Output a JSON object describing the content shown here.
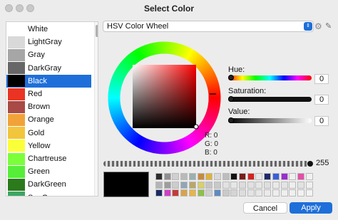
{
  "window": {
    "title": "Select Color"
  },
  "color_list": {
    "items": [
      {
        "label": "White",
        "color": "#ffffff"
      },
      {
        "label": "LightGray",
        "color": "#d9d9d9"
      },
      {
        "label": "Gray",
        "color": "#a6a6a6"
      },
      {
        "label": "DarkGray",
        "color": "#676767"
      },
      {
        "label": "Black",
        "color": "#000000",
        "selected": true
      },
      {
        "label": "Red",
        "color": "#ea3323"
      },
      {
        "label": "Brown",
        "color": "#a84a45"
      },
      {
        "label": "Orange",
        "color": "#f1a33a"
      },
      {
        "label": "Gold",
        "color": "#f2c53d"
      },
      {
        "label": "Yellow",
        "color": "#fbff3a"
      },
      {
        "label": "Chartreuse",
        "color": "#7bff3a"
      },
      {
        "label": "Green",
        "color": "#57ee3a"
      },
      {
        "label": "DarkGreen",
        "color": "#2b7a1c"
      },
      {
        "label": "SeaGreen",
        "color": "#3ea563"
      }
    ]
  },
  "mode_dropdown": {
    "value": "HSV Color Wheel"
  },
  "sliders": {
    "hue": {
      "label": "Hue:",
      "value": "0"
    },
    "saturation": {
      "label": "Saturation:",
      "value": "0"
    },
    "value": {
      "label": "Value:",
      "value": "0"
    }
  },
  "rgb_readout": {
    "r": "R: 0",
    "g": "G: 0",
    "b": "B: 0"
  },
  "opacity": {
    "value": "255"
  },
  "swatches": {
    "row1": [
      "#2d2d2d",
      "#8f8f8f",
      "#cfcfcf",
      "#b9b9b9",
      "#9ab0b0",
      "#c78a3d",
      "#e0b23c",
      "#d8d8d8",
      "#bdbdbd",
      "#111111",
      "#7a1c1c",
      "#d62020",
      "#e6e6e6",
      "#1e2a6a",
      "#3a5fd8",
      "#9b2ccf",
      "#f0f0f0",
      "#e34fa8",
      "#f1f1f1"
    ],
    "row2": [
      "#b4b4b4",
      "#9d9d9d",
      "#cccccc",
      "#8fa6b8",
      "#b8a86a",
      "#d9cf6c",
      "#c4c4c4",
      "#c8c8c8",
      "#e2e2e2",
      "#e6e6e6",
      "#dcdcdc",
      "#e1e1e1",
      "#e6e6e6",
      "#dedede",
      "#e9e9e9",
      "#e4e4e4",
      "#eeeeee",
      "#e2e2e2",
      "#f0f0f0"
    ],
    "row3": [
      "#1b2a64",
      "#d03fc6",
      "#c43a3a",
      "#d9a24a",
      "#e6b54a",
      "#8fbf4a",
      "#cfcfcf",
      "#5f8ac2",
      "#c9c9c9",
      "#d4d4d4",
      "#dddddd",
      "#e3e3e3",
      "#e7e7e7",
      "#eaeaea",
      "#ededed",
      "#efefef",
      "#f0f0f0",
      "#f2f2f2",
      "#f3f3f3"
    ]
  },
  "buttons": {
    "cancel": "Cancel",
    "apply": "Apply"
  },
  "accent_color": "#1e6fd9"
}
